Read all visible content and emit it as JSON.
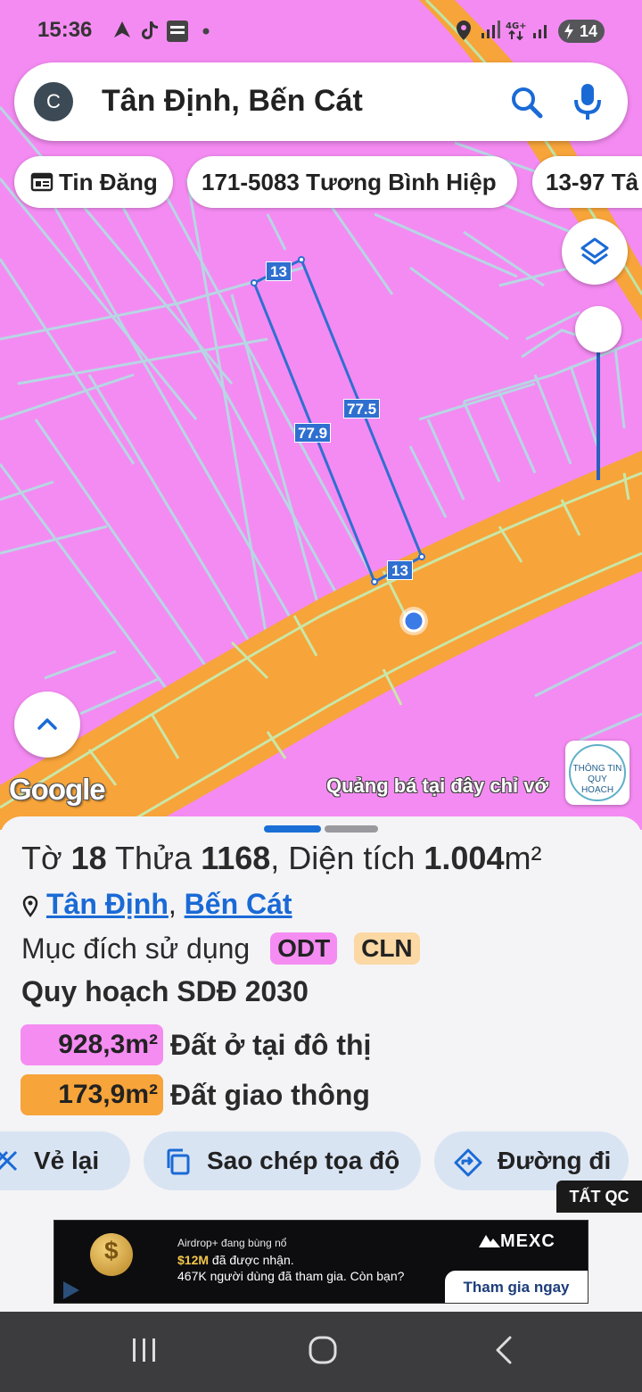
{
  "status": {
    "time": "15:36",
    "battery": "14"
  },
  "search": {
    "avatar_letter": "C",
    "query": "Tân Định, Bến Cát"
  },
  "chips": [
    {
      "label": "Tin Đăng"
    },
    {
      "label": "171-5083 Tương Bình Hiệp"
    },
    {
      "label": "13-97 Tâ"
    }
  ],
  "map": {
    "measurements": {
      "top": "13",
      "right": "77.5",
      "left": "77.9",
      "bottom": "13"
    },
    "google_label": "Google",
    "ad_overlay": "Quảng bá tại đây chỉ vớ",
    "badge": {
      "line1": "THÔNG TIN",
      "line2": "QUY HOẠCH"
    },
    "colors": {
      "residential": "#f48bf2",
      "road": "#f7a43a",
      "boundary": "#2f6fd0"
    }
  },
  "parcel": {
    "sheet_label": "Tờ",
    "sheet_no": "18",
    "plot_label": "Thửa",
    "plot_no": "1168",
    "area_label": ", Diện tích",
    "area_value": "1.004",
    "area_unit": "m²",
    "ward": "Tân Định",
    "district": "Bến Cát",
    "purpose_label": "Mục đích sử dụng",
    "purpose_tags": [
      "ODT",
      "CLN"
    ],
    "plan_title": "Quy hoạch SDĐ 2030",
    "land_uses": [
      {
        "area": "928,3m²",
        "name": "Đất ở tại đô thị"
      },
      {
        "area": "173,9m²",
        "name": "Đất giao thông"
      }
    ]
  },
  "actions": {
    "redraw": "Vẻ lại",
    "copy": "Sao chép tọa độ",
    "route": "Đường đi"
  },
  "ad": {
    "hide_label": "TẤT QC",
    "line1": "Airdrop+ đang bùng nổ",
    "line2_highlight": "$12M",
    "line2_rest": " đã được nhận.",
    "line3": "467K người dùng đã tham gia. Còn bạn?",
    "brand": "MEXC",
    "cta": "Tham gia ngay"
  }
}
